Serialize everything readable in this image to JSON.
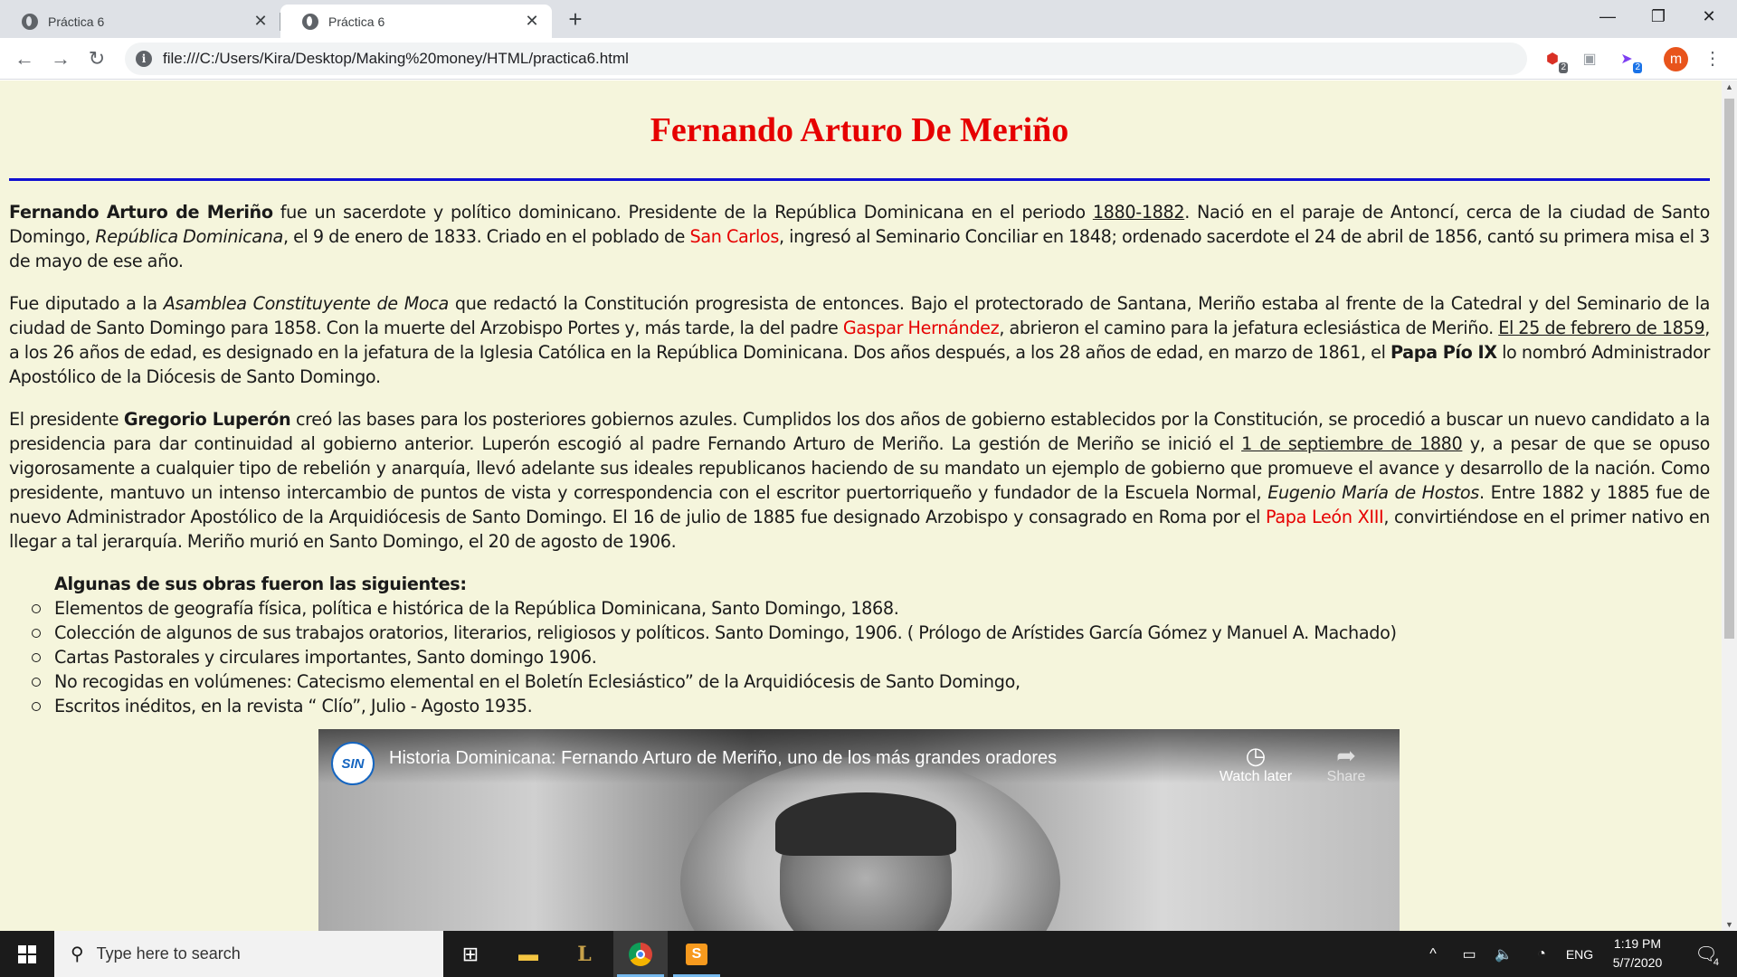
{
  "browser": {
    "tabs": [
      {
        "title": "Práctica 6",
        "active": false
      },
      {
        "title": "Práctica 6",
        "active": true
      }
    ],
    "url": "file:///C:/Users/Kira/Desktop/Making%20money/HTML/practica6.html",
    "extensions": [
      {
        "name": "ublock-extension-icon",
        "badge": "2",
        "color": "#d93025"
      },
      {
        "name": "grey-extension-icon",
        "badge": "",
        "color": "#9aa0a6"
      },
      {
        "name": "send-extension-icon",
        "badge": "2",
        "color": "#7e3ff2"
      }
    ],
    "profile_initial": "m",
    "profile_color": "#e8541c"
  },
  "page": {
    "title": "Fernando Arturo De Meriño",
    "title_color": "#e60000",
    "rule_color": "#1010d0",
    "background": "#f5f5dc",
    "p1": {
      "b1": "Fernando Arturo de Meriño",
      "t1": " fue un sacerdote y político dominicano. Presidente de la República Dominicana en el periodo ",
      "u1": "1880-1882",
      "t2": ". Nació en el paraje de Antoncí, cerca de la ciudad de Santo Domingo, ",
      "i1": "República Dominicana",
      "t3": ", el 9 de enero de 1833. Criado en el poblado de ",
      "r1": "San Carlos",
      "t4": ", ingresó al Seminario Conciliar en 1848; ordenado sacerdote el 24 de abril de 1856, cantó su primera misa el 3 de mayo de ese año."
    },
    "p2": {
      "t1": "Fue diputado a la ",
      "i1": "Asamblea Constituyente de Moca",
      "t2": " que redactó la Constitución progresista de entonces. Bajo el protectorado de Santana, Meriño estaba al frente de la Catedral y del Seminario de la ciudad de Santo Domingo para 1858. Con la muerte del Arzobispo Portes y, más tarde, la del padre ",
      "r1": "Gaspar Hernández",
      "t3": ", abrieron el camino para la jefatura eclesiástica de Meriño. ",
      "u1": "El 25 de febrero de 1859",
      "t4": ", a los 26 años de edad, es designado en la jefatura de la Iglesia Católica en la República Dominicana. Dos años después, a los 28 años de edad, en marzo de 1861, el ",
      "b1": "Papa Pío IX",
      "t5": " lo nombró Administrador Apostólico de la Diócesis de Santo Domingo."
    },
    "p3": {
      "t1": "El presidente ",
      "b1": "Gregorio Luperón",
      "t2": " creó las bases para los posteriores gobiernos azules. Cumplidos los dos años de gobierno establecidos por la Constitución, se procedió a buscar un nuevo candidato a la presidencia para dar continuidad al gobierno anterior. Luperón escogió al padre Fernando Arturo de Meriño. La gestión de Meriño se inició el ",
      "u1": "1 de septiembre de 1880",
      "t3": " y, a pesar de que se opuso vigorosamente a cualquier tipo de rebelión y anarquía, llevó adelante sus ideales republicanos haciendo de su mandato un ejemplo de gobierno que promueve el avance y desarrollo de la nación. Como presidente, mantuvo un intenso intercambio de puntos de vista y correspondencia con el escritor puertorriqueño y fundador de la Escuela Normal, ",
      "i1": "Eugenio María de Hostos",
      "t4": ". Entre 1882 y 1885 fue de nuevo Administrador Apostólico de la Arquidiócesis de Santo Domingo. El 16 de julio de 1885 fue designado Arzobispo y consagrado en Roma por el ",
      "r1": "Papa León XIII",
      "t5": ", convirtiéndose en el primer nativo en llegar a tal jerarquía. Meriño murió en Santo Domingo, el 20 de agosto de 1906."
    },
    "works": {
      "heading": "Algunas de sus obras fueron las siguientes:",
      "items": [
        "Elementos de geografía física, política e histórica de la República Dominicana, Santo Domingo, 1868.",
        "Colección de algunos de sus trabajos oratorios, literarios, religiosos y políticos. Santo Domingo, 1906. ( Prólogo de Arístides García Gómez y Manuel A. Machado)",
        "Cartas Pastorales y circulares importantes, Santo domingo 1906.",
        "No recogidas en volúmenes: Catecismo elemental en el Boletín Eclesiástico” de la Arquidiócesis de Santo Domingo,",
        "Escritos inéditos, en la revista “ Clío”, Julio - Agosto 1935."
      ]
    },
    "video": {
      "channel_logo_text": "SIN",
      "title": "Historia Dominicana: Fernando Arturo de Meriño, uno de los más grandes oradores",
      "watch_later": "Watch later",
      "share": "Share"
    }
  },
  "taskbar": {
    "search_placeholder": "Type here to search",
    "language": "ENG",
    "time": "1:19 PM",
    "date": "5/7/2020",
    "notification_count": "4"
  }
}
